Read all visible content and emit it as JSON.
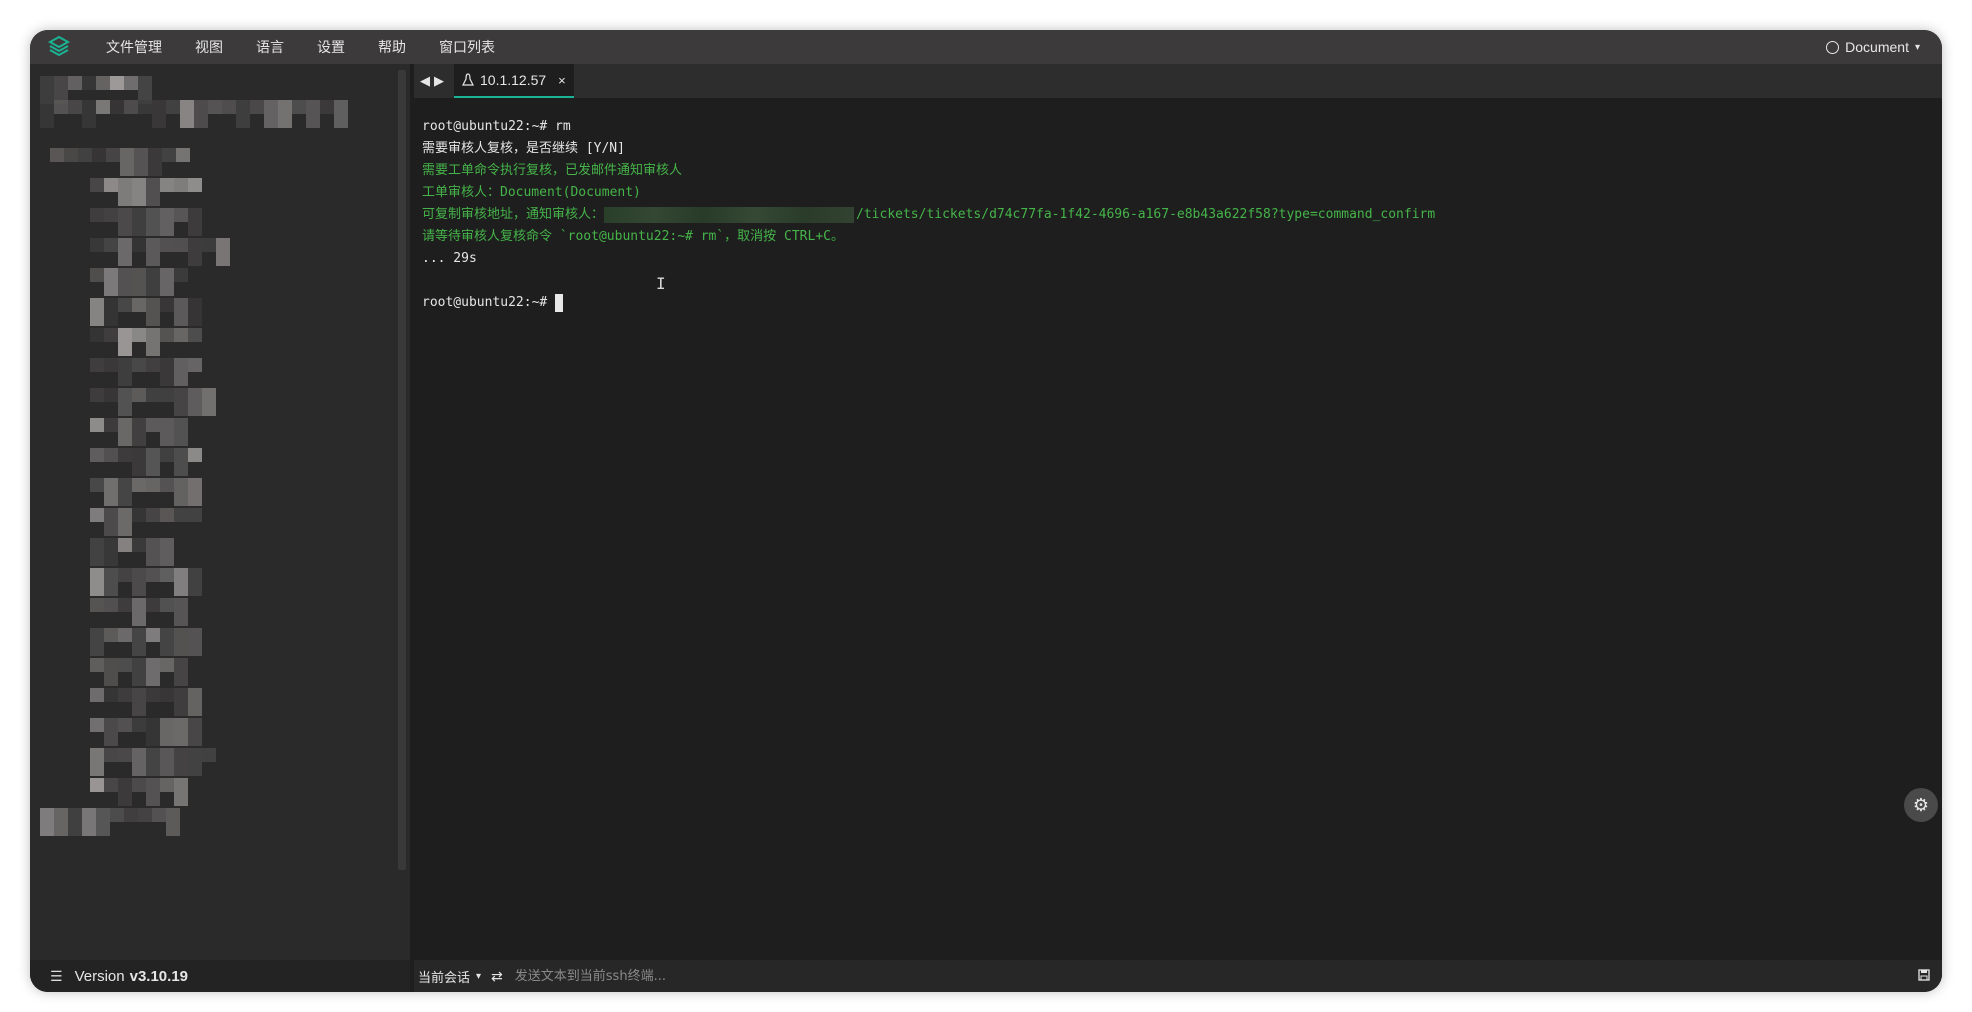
{
  "menu": {
    "items": [
      "文件管理",
      "视图",
      "语言",
      "设置",
      "帮助",
      "窗口列表"
    ],
    "user": "Document"
  },
  "sidebar": {
    "version_label": "Version",
    "version_value": "v3.10.19"
  },
  "tabs": [
    {
      "label": "10.1.12.57",
      "close": "×"
    }
  ],
  "terminal": {
    "lines": [
      {
        "text": "root@ubuntu22:~# rm",
        "color": "default"
      },
      {
        "text": "需要审核人复核，是否继续 [Y/N]",
        "color": "default"
      },
      {
        "text": "需要工单命令执行复核，已发邮件通知审核人",
        "color": "green"
      },
      {
        "text": "工单审核人：Document(Document)",
        "color": "green"
      },
      {
        "text_prefix": "可复制审核地址，通知审核人：",
        "text_suffix": "/tickets/tickets/d74c77fa-1f42-4696-a167-e8b43a622f58?type=command_confirm",
        "color": "green"
      },
      {
        "text": "请等待审核人复核命令 `root@ubuntu22:~# rm`，取消按 CTRL+C。",
        "color": "green"
      },
      {
        "text": "... 29s",
        "color": "default"
      },
      {
        "text": "",
        "color": "default"
      },
      {
        "text": "root@ubuntu22:~# ",
        "color": "default"
      }
    ]
  },
  "input_bar": {
    "session_label": "当前会话",
    "placeholder": "发送文本到当前ssh终端..."
  },
  "colors": {
    "accent": "#1ab394",
    "terminal_green": "#45b449",
    "terminal_bg": "#1e1e1e"
  },
  "icons": {
    "logo": "jumpserver-logo-icon",
    "user": "user-circle-icon",
    "settings": "gear-icon",
    "swap": "swap-icon",
    "save": "save-icon",
    "list": "list-icon"
  }
}
